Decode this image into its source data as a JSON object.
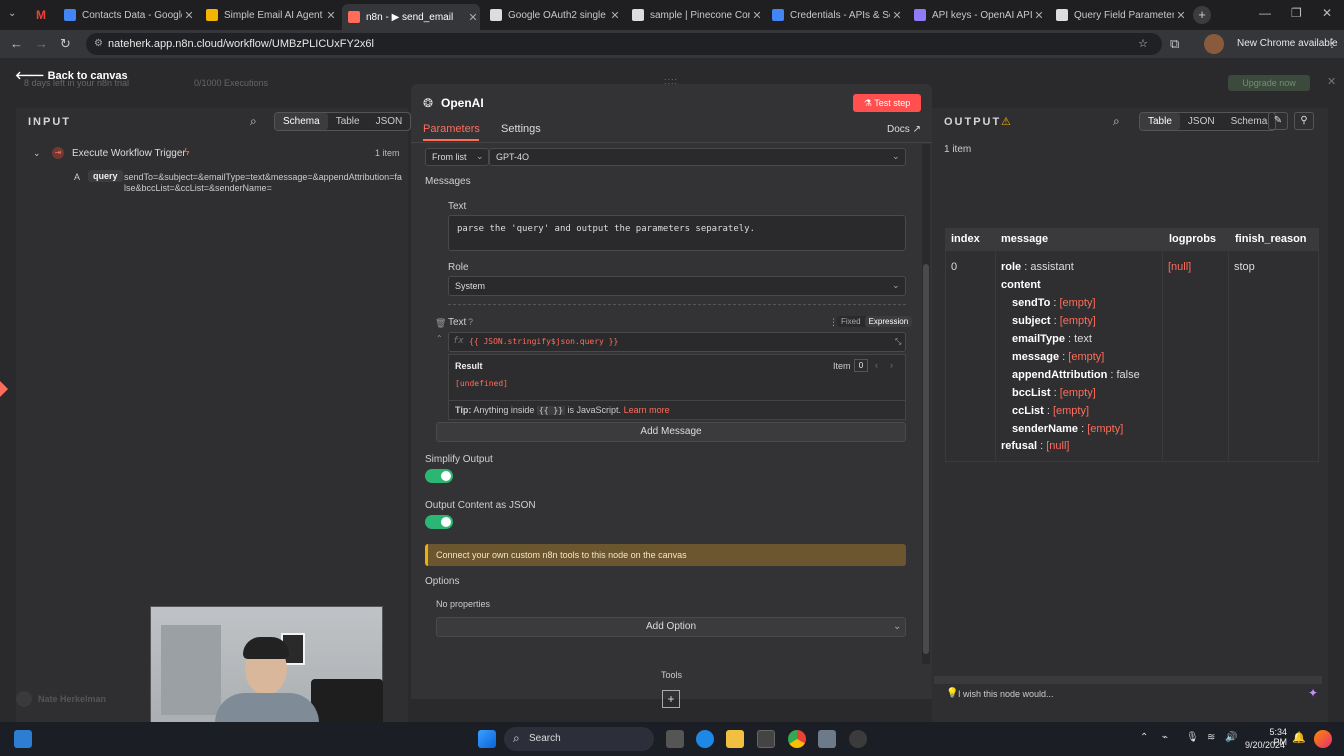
{
  "browser": {
    "tabs": [
      {
        "label": "Contacts Data - Google",
        "color": "#4285f4"
      },
      {
        "label": "Simple Email AI Agent -",
        "color": "#f4b400"
      },
      {
        "label": "n8n - ▶ send_email",
        "color": "#ff6d5a"
      },
      {
        "label": "Google OAuth2 single s",
        "color": "#dddddd"
      },
      {
        "label": "sample | Pinecone Cons",
        "color": "#dddddd"
      },
      {
        "label": "Credentials - APIs & Se",
        "color": "#4285f4"
      },
      {
        "label": "API keys - OpenAI API",
        "color": "#8e7cf8"
      },
      {
        "label": "Query Field Parameters",
        "color": "#dddddd"
      }
    ],
    "url": "nateherk.app.n8n.cloud/workflow/UMBzPLICUxFY2x6l",
    "profile_label": "New Chrome available"
  },
  "background": {
    "back_label": "Back to canvas",
    "trial_text": "8 days left in your n8n trial",
    "executions": "0/1000 Executions",
    "upgrade_label": "Upgrade now",
    "user_name": "Nate Herkelman"
  },
  "input": {
    "title": "INPUT",
    "views": [
      "Schema",
      "Table",
      "JSON"
    ],
    "node_name": "Execute Workflow Trigger",
    "item_count": "1 item",
    "field_type": "A",
    "field_name": "query",
    "field_value": "sendTo=&subject=&emailType=text&message=&appendAttribution=false&bccList=&ccList=&senderName="
  },
  "node": {
    "title": "OpenAI",
    "test_label": "Test step",
    "tabs": [
      "Parameters",
      "Settings"
    ],
    "docs_label": "Docs",
    "model_mode": "From list",
    "model": "GPT-4O",
    "messages_label": "Messages",
    "text_label": "Text",
    "text_value": "parse the 'query' and output the parameters separately.",
    "role_label": "Role",
    "role_value": "System",
    "text2_label": "Text",
    "fixed_label": "Fixed",
    "expression_label": "Expression",
    "expression_value": "{{ JSON.stringify$json.query }}",
    "result_label": "Result",
    "item_label": "Item",
    "item_index": "0",
    "result_value": "[undefined]",
    "tip_prefix": "Tip:",
    "tip_text": "Anything inside",
    "tip_code": "{{ }}",
    "tip_suffix": "is JavaScript.",
    "learn_more": "Learn more",
    "add_message": "Add Message",
    "simplify_label": "Simplify Output",
    "json_label": "Output Content as JSON",
    "notice": "Connect your own custom n8n tools to this node on the canvas",
    "options_label": "Options",
    "no_props": "No properties",
    "add_option": "Add Option",
    "tools_label": "Tools"
  },
  "output": {
    "title": "OUTPUT",
    "views": [
      "Table",
      "JSON",
      "Schema"
    ],
    "item_count": "1 item",
    "columns": [
      "index",
      "message",
      "logprobs",
      "finish_reason"
    ],
    "index": "0",
    "logprobs": "[null]",
    "finish_reason": "stop",
    "role_key": "role",
    "role_val": "assistant",
    "content_key": "content",
    "rows": [
      {
        "k": "sendTo",
        "v": "[empty]"
      },
      {
        "k": "subject",
        "v": "[empty]"
      },
      {
        "k": "emailType",
        "v": "text"
      },
      {
        "k": "message",
        "v": "[empty]"
      },
      {
        "k": "appendAttribution",
        "v": "false"
      },
      {
        "k": "bccList",
        "v": "[empty]"
      },
      {
        "k": "ccList",
        "v": "[empty]"
      },
      {
        "k": "senderName",
        "v": "[empty]"
      }
    ],
    "refusal_key": "refusal",
    "refusal_val": "[null]",
    "feedback": "I wish this node would..."
  },
  "taskbar": {
    "search": "Search",
    "time": "5:34 PM",
    "date": "9/20/2024"
  }
}
